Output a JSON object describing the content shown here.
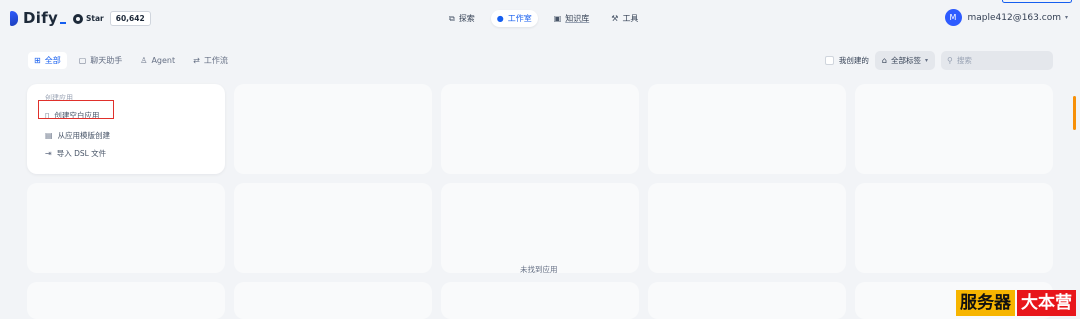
{
  "header": {
    "logo_text": "Dify",
    "github": {
      "star_label": "Star",
      "star_count": "60,642"
    },
    "nav": [
      {
        "label": "探索",
        "icon": "compass-icon",
        "active": false
      },
      {
        "label": "工作室",
        "icon": "robot-icon",
        "active": true
      },
      {
        "label": "知识库",
        "icon": "book-icon",
        "active": false
      },
      {
        "label": "工具",
        "icon": "hammer-icon",
        "active": false
      }
    ],
    "user": {
      "avatar_letter": "M",
      "email": "maple412@163.com"
    }
  },
  "filter_tabs": [
    {
      "label": "全部",
      "icon": "grid-icon",
      "active": true
    },
    {
      "label": "聊天助手",
      "icon": "chat-icon",
      "active": false
    },
    {
      "label": "Agent",
      "icon": "agent-icon",
      "active": false
    },
    {
      "label": "工作流",
      "icon": "workflow-icon",
      "active": false
    }
  ],
  "filters": {
    "created_by_me": "我创建的",
    "tags": "全部标签",
    "search_placeholder": "搜索"
  },
  "create_card": {
    "title": "创建应用",
    "items": [
      {
        "label": "创建空白应用",
        "icon": "file-plus-icon"
      },
      {
        "label": "从应用模版创建",
        "icon": "template-icon"
      },
      {
        "label": "导入 DSL 文件",
        "icon": "import-icon"
      }
    ]
  },
  "empty_message": "未找到应用",
  "watermark": {
    "part_a": "服务器",
    "part_b": "大本营"
  }
}
